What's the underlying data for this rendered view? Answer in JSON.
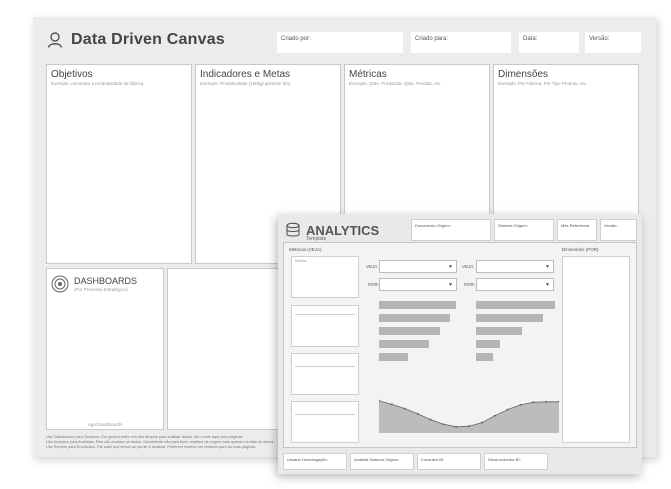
{
  "canvas": {
    "title": "Data Driven Canvas",
    "header_fields": [
      "Criado por:",
      "Criado para:",
      "Data:",
      "Versão:"
    ],
    "panels": [
      {
        "title": "Objetivos",
        "example": "Exemplo: Aumentar a produtividade da fábrica."
      },
      {
        "title": "Indicadores e Metas",
        "example": "Exemplo: Produtividade (100kg/ gerente/ dia)"
      },
      {
        "title": "Métricas",
        "example": "Exemplo: Qtde. Produzida, Qtde. Perdida, etc."
      },
      {
        "title": "Dimensões",
        "example": "Exemplo: Por Fábrica, Por Tipo Produto, etc."
      }
    ],
    "dashboards": {
      "title": "DASHBOARDS",
      "subtitle": "(Por Processo Estratégico)",
      "bottom_label": "Agul Dashboards"
    },
    "footnotes": [
      "Use Dashboards para Gestores. Em geral é entre mín dez tempos para analisar dados. Me o este aqui seus páginas.",
      "Use Analytics para Analistas. Eles vão analisar os dados. Geralmente são para fazer análises de origem mas quando ha falta de dados.",
      "Use Reports para Envolvidos. Ele sabe que temos as perder e analisar. Preferem receber um relatório para as suas páginas."
    ]
  },
  "analytics": {
    "title": "ANALYTICS",
    "subtitle": "Template",
    "header_fields": [
      "Documento Origem:",
      "Sistema Origem:",
      "Mês Referência:",
      "Versão:"
    ],
    "metrics_label": "Métricas (VEJA)",
    "metric_placeholder": "Métrica",
    "dimensions_label": "Dimensões (POR)",
    "veja_label": "VEJA:",
    "por_label": "POR:",
    "footer_fields": [
      "Usuário Homologação:",
      "Analista Sistema Origem:",
      "Consultor BI:",
      "Desenvolvedor BI:"
    ],
    "bar_chart_left": [
      0.8,
      0.74,
      0.64,
      0.52,
      0.3
    ],
    "bar_chart_right": [
      0.82,
      0.7,
      0.48,
      0.25,
      0.18
    ],
    "area_chart": [
      0.62,
      0.55,
      0.47,
      0.37,
      0.26,
      0.17,
      0.12,
      0.13,
      0.2,
      0.33,
      0.45,
      0.54,
      0.59,
      0.6,
      0.6
    ],
    "colors": {
      "bar": "#b5b5b5",
      "area": "#bcbcbc",
      "line": "#666666"
    }
  },
  "icons": [
    "user-icon",
    "target-icon",
    "database-icon",
    "chevron-down-icon"
  ]
}
